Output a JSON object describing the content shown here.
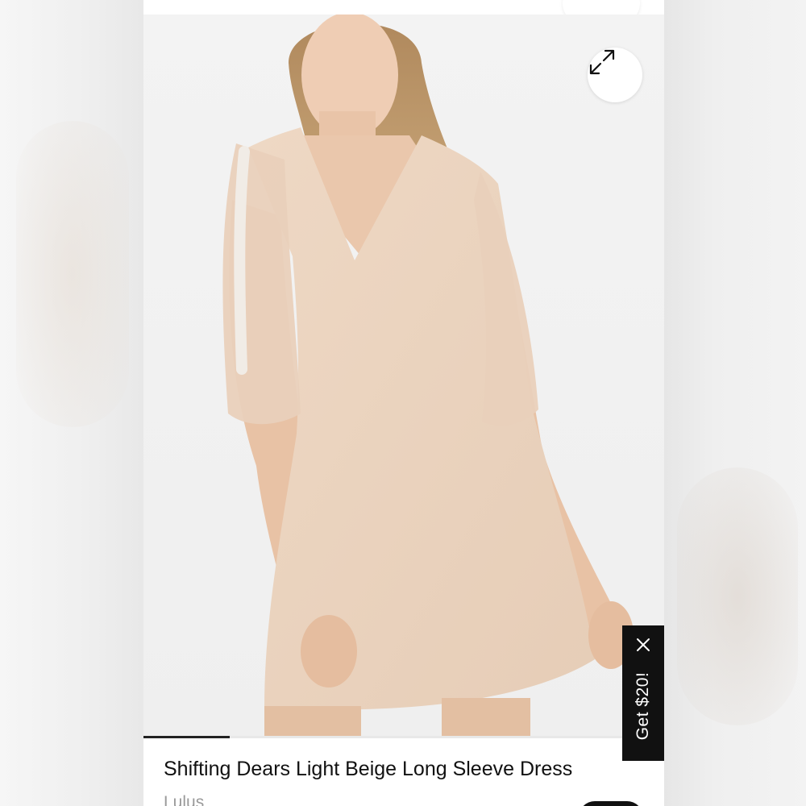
{
  "product": {
    "title": "Shifting Dears Light Beige Long Sleeve Dress",
    "brand": "Lulus"
  },
  "promo": {
    "label": "Get $20!"
  },
  "gallery": {
    "progress_fraction": 0.165
  },
  "icons": {
    "expand": "expand-arrows-icon",
    "close": "close-icon"
  },
  "colors": {
    "promo_background": "#111111",
    "title_text": "#111111",
    "brand_text": "#9a9a9a",
    "dress": "#ecd4bf"
  }
}
